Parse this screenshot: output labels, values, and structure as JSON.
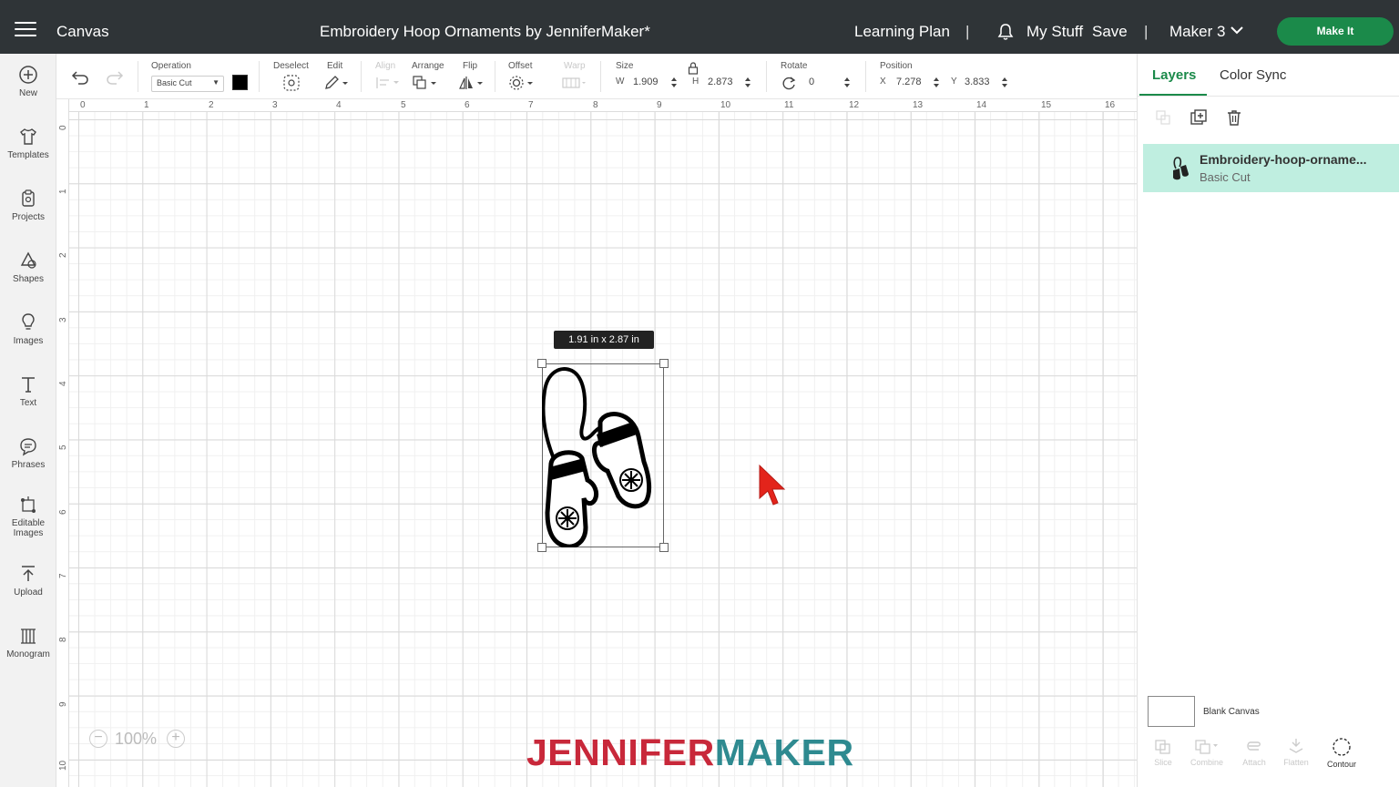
{
  "topbar": {
    "canvas_label": "Canvas",
    "project_title": "Embroidery Hoop Ornaments by JenniferMaker*",
    "learning_plan": "Learning Plan",
    "separator": "|",
    "my_stuff": "My Stuff",
    "save": "Save",
    "machine": "Maker 3",
    "make_it": "Make It"
  },
  "sidebar": {
    "items": [
      {
        "label": "New",
        "icon": "plus-circle-icon"
      },
      {
        "label": "Templates",
        "icon": "shirt-icon"
      },
      {
        "label": "Projects",
        "icon": "clipboard-icon"
      },
      {
        "label": "Shapes",
        "icon": "shapes-icon"
      },
      {
        "label": "Images",
        "icon": "lightbulb-icon"
      },
      {
        "label": "Text",
        "icon": "text-t-icon"
      },
      {
        "label": "Phrases",
        "icon": "speech-bubble-icon"
      },
      {
        "label": "Editable Images",
        "icon": "editable-image-icon"
      },
      {
        "label": "Upload",
        "icon": "upload-icon"
      },
      {
        "label": "Monogram",
        "icon": "monogram-icon"
      }
    ]
  },
  "toolbar": {
    "operation_label": "Operation",
    "operation_value": "Basic Cut",
    "deselect_label": "Deselect",
    "edit_label": "Edit",
    "align_label": "Align",
    "arrange_label": "Arrange",
    "flip_label": "Flip",
    "offset_label": "Offset",
    "warp_label": "Warp",
    "size_label": "Size",
    "w_label": "W",
    "w_value": "1.909",
    "h_label": "H",
    "h_value": "2.873",
    "rotate_label": "Rotate",
    "rotate_value": "0",
    "position_label": "Position",
    "x_label": "X",
    "x_value": "7.278",
    "y_label": "Y",
    "y_value": "3.833",
    "swatch_color": "#000000"
  },
  "ruler": {
    "top": [
      "0",
      "1",
      "2",
      "3",
      "4",
      "5",
      "6",
      "7",
      "8",
      "9",
      "10",
      "11",
      "12",
      "13",
      "14",
      "15",
      "16"
    ],
    "left": [
      "0",
      "1",
      "2",
      "3",
      "4",
      "5",
      "6",
      "7",
      "8",
      "9",
      "10"
    ]
  },
  "canvas": {
    "size_tooltip": "1.91  in x 2.87  in",
    "zoom": "100%",
    "logo_part1": "JENNIFER",
    "logo_part2": "MAKER"
  },
  "panel": {
    "tab_layers": "Layers",
    "tab_color_sync": "Color Sync",
    "layer_name": "Embroidery-hoop-orname...",
    "layer_operation": "Basic Cut",
    "blank_canvas": "Blank Canvas",
    "buttons": [
      "Slice",
      "Combine",
      "Attach",
      "Flatten",
      "Contour"
    ]
  },
  "colors": {
    "accent": "#1b8a4a",
    "topbar": "#2f3437",
    "layer_highlight": "#bfeee0",
    "logo_red": "#c8283a",
    "logo_teal": "#2e8a90",
    "cursor": "#e3241b"
  }
}
